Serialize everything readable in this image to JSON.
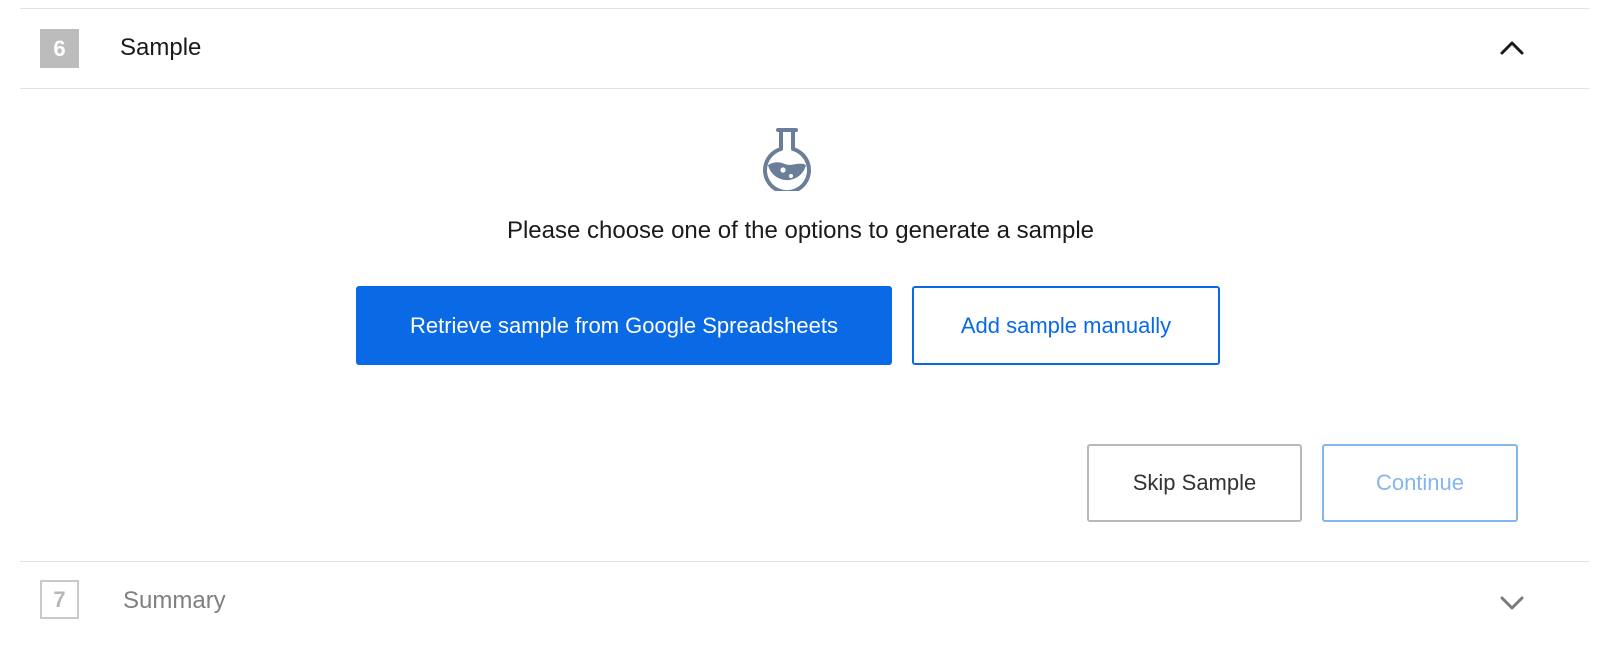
{
  "step_active": {
    "number": "6",
    "title": "Sample",
    "toggle_icon": "chevron-up-icon"
  },
  "sample_panel": {
    "icon": "flask-icon",
    "prompt": "Please choose one of the options to generate a sample",
    "retrieve_label": "Retrieve sample from Google Spreadsheets",
    "manual_label": "Add sample manually",
    "skip_label": "Skip Sample",
    "continue_label": "Continue"
  },
  "step_next": {
    "number": "7",
    "title": "Summary",
    "toggle_icon": "chevron-down-icon"
  },
  "colors": {
    "accent": "#0a6ae6",
    "accent_disabled": "#86b4ee",
    "step_badge": "#bcbcbc",
    "divider": "#e2e2e2"
  }
}
